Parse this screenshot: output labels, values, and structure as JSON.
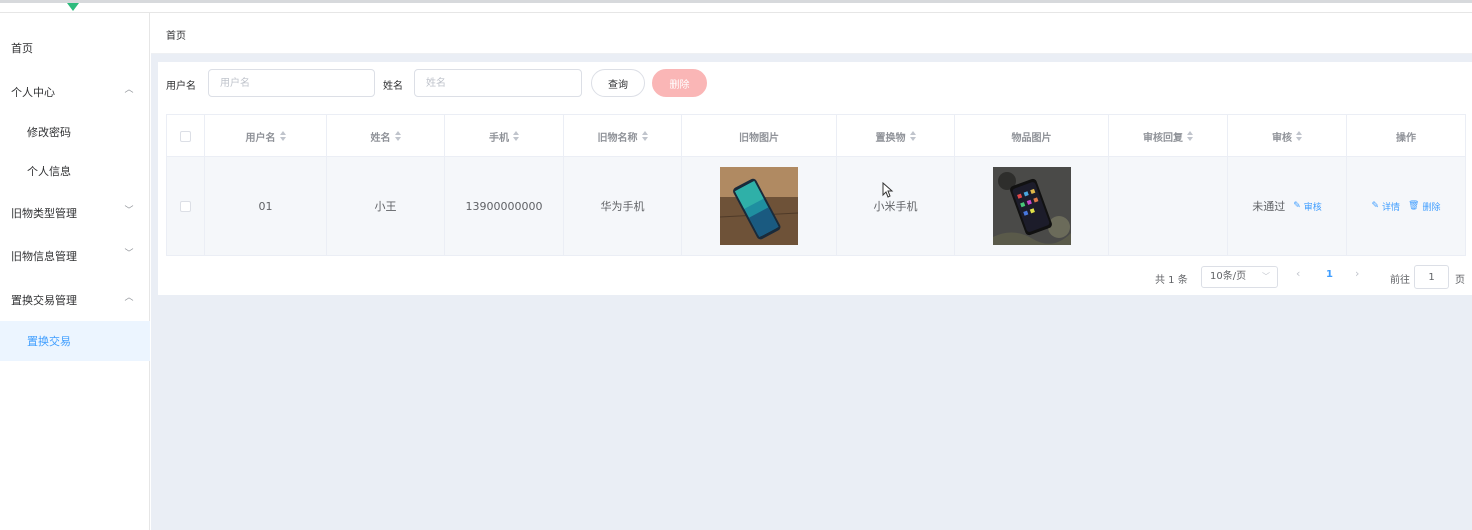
{
  "sidebar": {
    "items": [
      {
        "label": "首页"
      },
      {
        "label": "个人中心"
      },
      {
        "label": "修改密码"
      },
      {
        "label": "个人信息"
      },
      {
        "label": "旧物类型管理"
      },
      {
        "label": "旧物信息管理"
      },
      {
        "label": "置换交易管理"
      },
      {
        "label": "置换交易"
      }
    ]
  },
  "breadcrumb": {
    "home": "首页"
  },
  "search": {
    "username_label": "用户名",
    "username_placeholder": "用户名",
    "name_label": "姓名",
    "name_placeholder": "姓名",
    "query_label": "查询",
    "delete_label": "删除"
  },
  "table": {
    "headers": [
      "用户名",
      "姓名",
      "手机",
      "旧物名称",
      "旧物图片",
      "置换物",
      "物品图片",
      "审核回复",
      "审核",
      "操作"
    ],
    "rows": [
      {
        "username": "01",
        "name": "小王",
        "phone": "13900000000",
        "item_name": "华为手机",
        "exchange_item": "小米手机",
        "review_reply": "",
        "review_status": "未通过",
        "review_action": "审核",
        "detail_action": "详情",
        "delete_action": "删除"
      }
    ]
  },
  "pagination": {
    "total": "共 1 条",
    "page_size": "10条/页",
    "current_page": "1",
    "goto_label": "前往",
    "goto_value": "1",
    "page_unit": "页"
  },
  "colors": {
    "accent": "#409eff",
    "brand": "#2dbb7d",
    "delete_button": "#fab6b6",
    "active_menu_bg": "#ecf5ff"
  }
}
